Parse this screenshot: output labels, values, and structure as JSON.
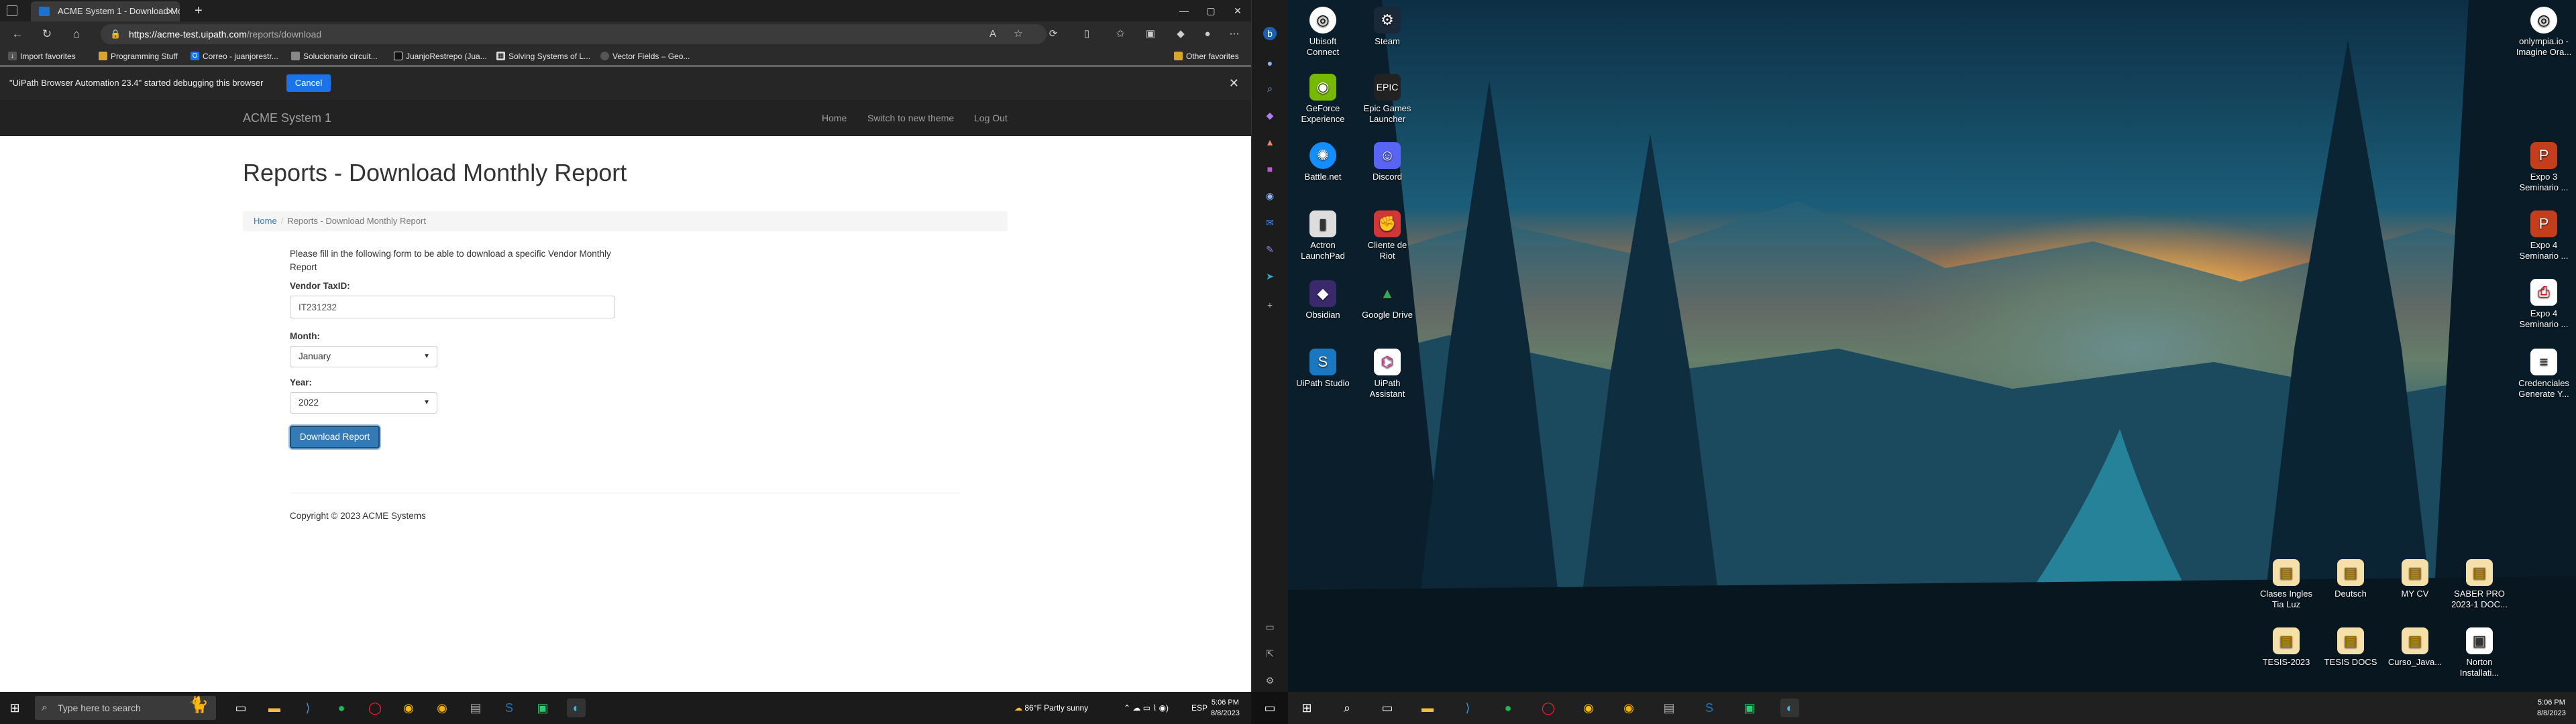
{
  "browser": {
    "tab_title": "ACME System 1 - Download Mo...",
    "url_host": "https://acme-test.uipath.com",
    "url_path": "/reports/download",
    "bookmarks": [
      "Import favorites",
      "Programming Stuff",
      "Correo - juanjorestr...",
      "Solucionario circuit...",
      "JuanjoRestrepo (Jua...",
      "Solving Systems of L...",
      "Vector Fields – Geo...",
      "Other favorites"
    ],
    "infobar_message": "\"UiPath Browser Automation 23.4\" started debugging this browser",
    "infobar_cancel": "Cancel"
  },
  "site": {
    "brand": "ACME System 1",
    "nav": [
      "Home",
      "Switch to new theme",
      "Log Out"
    ],
    "title": "Reports - Download Monthly Report",
    "breadcrumb_home": "Home",
    "breadcrumb_current": "Reports - Download Monthly Report",
    "intro": "Please fill in the following form to be able to download a specific Vendor Monthly Report",
    "vendor_label": "Vendor TaxID:",
    "vendor_value": "IT231232",
    "month_label": "Month:",
    "month_value": "January",
    "year_label": "Year:",
    "year_value": "2022",
    "download_button": "Download Report",
    "footer": "Copyright © 2023 ACME Systems"
  },
  "desktop": {
    "icons_left": [
      {
        "label": "Ubisoft Connect",
        "icon": "ubisoft-icon"
      },
      {
        "label": "Steam",
        "icon": "steam-icon"
      },
      {
        "label": "GeForce Experience",
        "icon": "geforce-icon"
      },
      {
        "label": "Epic Games Launcher",
        "icon": "epic-icon"
      },
      {
        "label": "Battle.net",
        "icon": "battlenet-icon"
      },
      {
        "label": "Discord",
        "icon": "discord-icon"
      },
      {
        "label": "Actron LaunchPad",
        "icon": "actron-icon"
      },
      {
        "label": "Cliente de Riot",
        "icon": "riot-icon"
      },
      {
        "label": "Obsidian",
        "icon": "obsidian-icon"
      },
      {
        "label": "Google Drive",
        "icon": "drive-icon"
      },
      {
        "label": "UiPath Studio",
        "icon": "uipath-studio-icon"
      },
      {
        "label": "UiPath Assistant",
        "icon": "uipath-assistant-icon"
      }
    ],
    "icons_right": [
      "onlympia.io - Imagine Ora...",
      "Expo 3 Seminario ...",
      "Expo 4 Seminario ...",
      "Expo 4 Seminario ...",
      "Credenciales Generate Y..."
    ],
    "icons_bottom": [
      "Clases Ingles Tia Luz",
      "Deutsch",
      "MY CV",
      "SABER PRO 2023-1 DOC...",
      "TESIS-2023",
      "TESIS DOCS",
      "Curso_Java...",
      "Norton Installati..."
    ]
  },
  "taskbar": {
    "search_placeholder": "Type here to search",
    "weather": "86°F  Partly sunny",
    "lang": "ESP",
    "time": "5:06 PM",
    "date": "8/8/2023"
  }
}
